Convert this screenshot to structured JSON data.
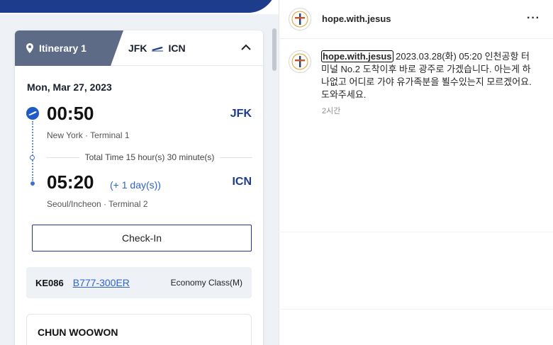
{
  "itinerary": {
    "tab_label": "Itinerary 1",
    "origin": "JFK",
    "destination": "ICN",
    "date": "Mon, Mar 27, 2023",
    "departure": {
      "time": "00:50",
      "code": "JFK",
      "place": "New York · Terminal 1"
    },
    "total_time": "Total Time 15 hour(s) 30 minute(s)",
    "arrival": {
      "time": "05:20",
      "day_offset": "(+ 1 day(s))",
      "code": "ICN",
      "place": "Seoul/Incheon · Terminal 2"
    },
    "checkin_label": "Check-In",
    "flight": {
      "number": "KE086",
      "aircraft": "B777-300ER",
      "cabin": "Economy Class(M)"
    },
    "passenger_name": "CHUN WOOWON"
  },
  "post": {
    "handle": "hope.with.jesus",
    "more_label": "···",
    "comment_user": "hope.with.jesus",
    "comment_text": "2023.03.28(화) 05:20 인천공항 터미널 No.2 도착이후 바로 광주로 가겠습니다. 아는게 하나없고 어디로 가야 유가족분을 뵐수있는지 모르겠어요. 도와주세요.",
    "comment_time": "2시간"
  },
  "colors": {
    "brand_navy": "#1e3c8c",
    "tab_gray": "#5d6b86",
    "link_blue": "#2f64c8",
    "panel_bg": "#eef1f6"
  },
  "icons": [
    "location-pin-icon",
    "airplane-icon",
    "chevron-up-icon",
    "takeoff-icon",
    "cross-avatar-icon",
    "more-icon"
  ]
}
